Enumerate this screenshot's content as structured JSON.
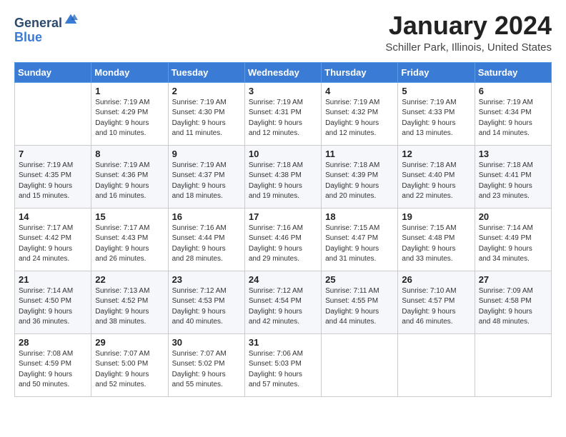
{
  "header": {
    "logo_general": "General",
    "logo_blue": "Blue",
    "title": "January 2024",
    "location": "Schiller Park, Illinois, United States"
  },
  "days_of_week": [
    "Sunday",
    "Monday",
    "Tuesday",
    "Wednesday",
    "Thursday",
    "Friday",
    "Saturday"
  ],
  "weeks": [
    [
      {
        "day": "",
        "sunrise": "",
        "sunset": "",
        "daylight": ""
      },
      {
        "day": "1",
        "sunrise": "Sunrise: 7:19 AM",
        "sunset": "Sunset: 4:29 PM",
        "daylight": "Daylight: 9 hours and 10 minutes."
      },
      {
        "day": "2",
        "sunrise": "Sunrise: 7:19 AM",
        "sunset": "Sunset: 4:30 PM",
        "daylight": "Daylight: 9 hours and 11 minutes."
      },
      {
        "day": "3",
        "sunrise": "Sunrise: 7:19 AM",
        "sunset": "Sunset: 4:31 PM",
        "daylight": "Daylight: 9 hours and 12 minutes."
      },
      {
        "day": "4",
        "sunrise": "Sunrise: 7:19 AM",
        "sunset": "Sunset: 4:32 PM",
        "daylight": "Daylight: 9 hours and 12 minutes."
      },
      {
        "day": "5",
        "sunrise": "Sunrise: 7:19 AM",
        "sunset": "Sunset: 4:33 PM",
        "daylight": "Daylight: 9 hours and 13 minutes."
      },
      {
        "day": "6",
        "sunrise": "Sunrise: 7:19 AM",
        "sunset": "Sunset: 4:34 PM",
        "daylight": "Daylight: 9 hours and 14 minutes."
      }
    ],
    [
      {
        "day": "7",
        "sunrise": "",
        "sunset": "",
        "daylight": ""
      },
      {
        "day": "8",
        "sunrise": "Sunrise: 7:19 AM",
        "sunset": "Sunset: 4:36 PM",
        "daylight": "Daylight: 9 hours and 16 minutes."
      },
      {
        "day": "9",
        "sunrise": "Sunrise: 7:19 AM",
        "sunset": "Sunset: 4:37 PM",
        "daylight": "Daylight: 9 hours and 18 minutes."
      },
      {
        "day": "10",
        "sunrise": "Sunrise: 7:18 AM",
        "sunset": "Sunset: 4:38 PM",
        "daylight": "Daylight: 9 hours and 19 minutes."
      },
      {
        "day": "11",
        "sunrise": "Sunrise: 7:18 AM",
        "sunset": "Sunset: 4:39 PM",
        "daylight": "Daylight: 9 hours and 20 minutes."
      },
      {
        "day": "12",
        "sunrise": "Sunrise: 7:18 AM",
        "sunset": "Sunset: 4:40 PM",
        "daylight": "Daylight: 9 hours and 22 minutes."
      },
      {
        "day": "13",
        "sunrise": "Sunrise: 7:18 AM",
        "sunset": "Sunset: 4:41 PM",
        "daylight": "Daylight: 9 hours and 23 minutes."
      }
    ],
    [
      {
        "day": "14",
        "sunrise": "",
        "sunset": "",
        "daylight": ""
      },
      {
        "day": "15",
        "sunrise": "Sunrise: 7:17 AM",
        "sunset": "Sunset: 4:43 PM",
        "daylight": "Daylight: 9 hours and 26 minutes."
      },
      {
        "day": "16",
        "sunrise": "Sunrise: 7:16 AM",
        "sunset": "Sunset: 4:44 PM",
        "daylight": "Daylight: 9 hours and 28 minutes."
      },
      {
        "day": "17",
        "sunrise": "Sunrise: 7:16 AM",
        "sunset": "Sunset: 4:46 PM",
        "daylight": "Daylight: 9 hours and 29 minutes."
      },
      {
        "day": "18",
        "sunrise": "Sunrise: 7:15 AM",
        "sunset": "Sunset: 4:47 PM",
        "daylight": "Daylight: 9 hours and 31 minutes."
      },
      {
        "day": "19",
        "sunrise": "Sunrise: 7:15 AM",
        "sunset": "Sunset: 4:48 PM",
        "daylight": "Daylight: 9 hours and 33 minutes."
      },
      {
        "day": "20",
        "sunrise": "Sunrise: 7:14 AM",
        "sunset": "Sunset: 4:49 PM",
        "daylight": "Daylight: 9 hours and 34 minutes."
      }
    ],
    [
      {
        "day": "21",
        "sunrise": "",
        "sunset": "",
        "daylight": ""
      },
      {
        "day": "22",
        "sunrise": "Sunrise: 7:13 AM",
        "sunset": "Sunset: 4:52 PM",
        "daylight": "Daylight: 9 hours and 38 minutes."
      },
      {
        "day": "23",
        "sunrise": "Sunrise: 7:12 AM",
        "sunset": "Sunset: 4:53 PM",
        "daylight": "Daylight: 9 hours and 40 minutes."
      },
      {
        "day": "24",
        "sunrise": "Sunrise: 7:12 AM",
        "sunset": "Sunset: 4:54 PM",
        "daylight": "Daylight: 9 hours and 42 minutes."
      },
      {
        "day": "25",
        "sunrise": "Sunrise: 7:11 AM",
        "sunset": "Sunset: 4:55 PM",
        "daylight": "Daylight: 9 hours and 44 minutes."
      },
      {
        "day": "26",
        "sunrise": "Sunrise: 7:10 AM",
        "sunset": "Sunset: 4:57 PM",
        "daylight": "Daylight: 9 hours and 46 minutes."
      },
      {
        "day": "27",
        "sunrise": "Sunrise: 7:09 AM",
        "sunset": "Sunset: 4:58 PM",
        "daylight": "Daylight: 9 hours and 48 minutes."
      }
    ],
    [
      {
        "day": "28",
        "sunrise": "Sunrise: 7:08 AM",
        "sunset": "Sunset: 4:59 PM",
        "daylight": "Daylight: 9 hours and 50 minutes."
      },
      {
        "day": "29",
        "sunrise": "Sunrise: 7:07 AM",
        "sunset": "Sunset: 5:00 PM",
        "daylight": "Daylight: 9 hours and 52 minutes."
      },
      {
        "day": "30",
        "sunrise": "Sunrise: 7:07 AM",
        "sunset": "Sunset: 5:02 PM",
        "daylight": "Daylight: 9 hours and 55 minutes."
      },
      {
        "day": "31",
        "sunrise": "Sunrise: 7:06 AM",
        "sunset": "Sunset: 5:03 PM",
        "daylight": "Daylight: 9 hours and 57 minutes."
      },
      {
        "day": "",
        "sunrise": "",
        "sunset": "",
        "daylight": ""
      },
      {
        "day": "",
        "sunrise": "",
        "sunset": "",
        "daylight": ""
      },
      {
        "day": "",
        "sunrise": "",
        "sunset": "",
        "daylight": ""
      }
    ]
  ],
  "week1_special": {
    "7": {
      "sunrise": "Sunrise: 7:19 AM",
      "sunset": "Sunset: 4:35 PM",
      "daylight": "Daylight: 9 hours and 15 minutes."
    },
    "14": {
      "sunrise": "Sunrise: 7:17 AM",
      "sunset": "Sunset: 4:42 PM",
      "daylight": "Daylight: 9 hours and 24 minutes."
    },
    "21": {
      "sunrise": "Sunrise: 7:14 AM",
      "sunset": "Sunset: 4:50 PM",
      "daylight": "Daylight: 9 hours and 36 minutes."
    }
  }
}
